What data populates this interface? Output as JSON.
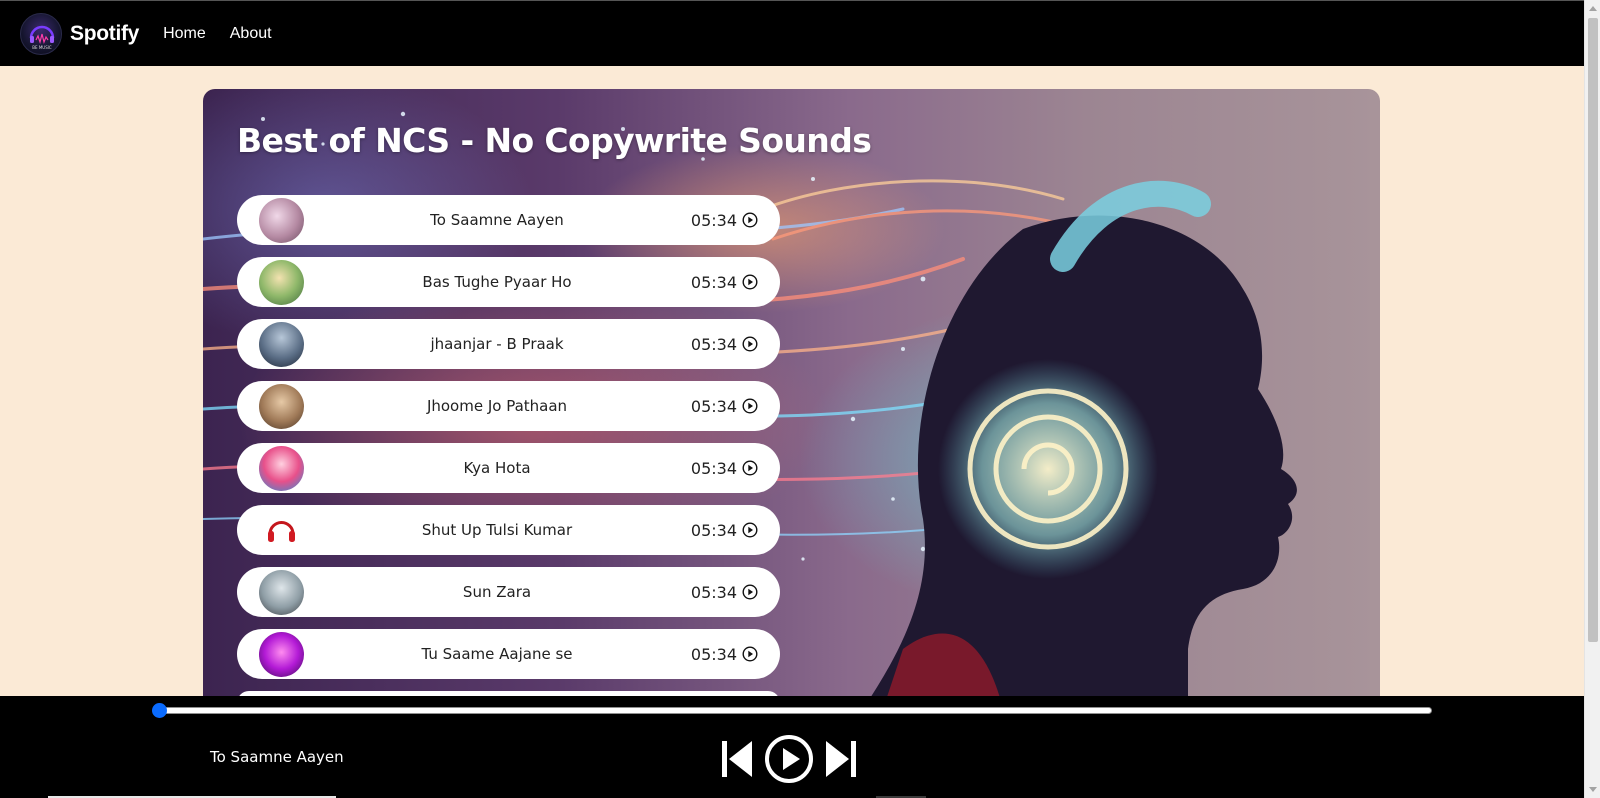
{
  "nav": {
    "brand": "Spotify",
    "logo_text": "BE MUSIC",
    "links": [
      "Home",
      "About"
    ]
  },
  "playlist": {
    "title": "Best of NCS - No Copywrite Sounds",
    "songs": [
      {
        "name": "To Saamne Aayen",
        "duration": "05:34"
      },
      {
        "name": "Bas Tughe Pyaar Ho",
        "duration": "05:34"
      },
      {
        "name": "jhaanjar - B Praak",
        "duration": "05:34"
      },
      {
        "name": "Jhoome Jo Pathaan",
        "duration": "05:34"
      },
      {
        "name": "Kya Hota",
        "duration": "05:34"
      },
      {
        "name": "Shut Up Tulsi Kumar",
        "duration": "05:34"
      },
      {
        "name": "Sun Zara",
        "duration": "05:34"
      },
      {
        "name": "Tu Saame Aajane se",
        "duration": "05:34"
      }
    ]
  },
  "player": {
    "now_playing": "To Saamne Aayen",
    "progress": 0,
    "accent_color": "#0a6bff"
  },
  "colors": {
    "page_bg": "#fbead6",
    "bar_bg": "#000000"
  }
}
